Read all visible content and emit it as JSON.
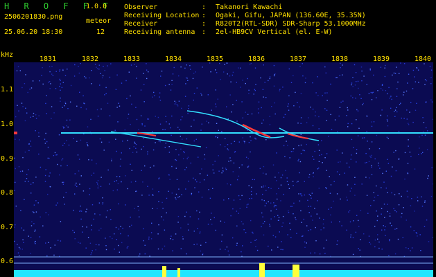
{
  "header": {
    "app_name": "H R O F F T",
    "version": "1.0.0",
    "filename": "2506201830.png",
    "meteor_label": "meteor",
    "datetime": "25.06.20 18:30",
    "meteor_count": "12",
    "info": [
      {
        "key": "Observer",
        "value": "Takanori Kawachi"
      },
      {
        "key": "Receiving Location",
        "value": "Ogaki, Gifu, JAPAN (136.60E, 35.35N)"
      },
      {
        "key": "Receiver",
        "value": "R820T2(RTL-SDR) SDR-Sharp 53.1000MHz"
      },
      {
        "key": "Receiving antenna",
        "value": "2el-HB9CV Vertical (el. E-W)"
      }
    ]
  },
  "axis": {
    "y_unit": "kHz",
    "x_ticks": [
      "1831",
      "1832",
      "1833",
      "1834",
      "1835",
      "1836",
      "1837",
      "1838",
      "1839",
      "1840"
    ],
    "y_ticks": [
      "1.1",
      "1.0",
      "0.9",
      "0.8",
      "0.7",
      "0.6"
    ]
  },
  "colors": {
    "label": "#ffe000",
    "title": "#2fd02f",
    "background": "#0a0a4a",
    "carrier": "#33e0ff",
    "trail": "#ff3a3a",
    "power": "#22e6ff",
    "burst": "#ffff3a"
  }
}
